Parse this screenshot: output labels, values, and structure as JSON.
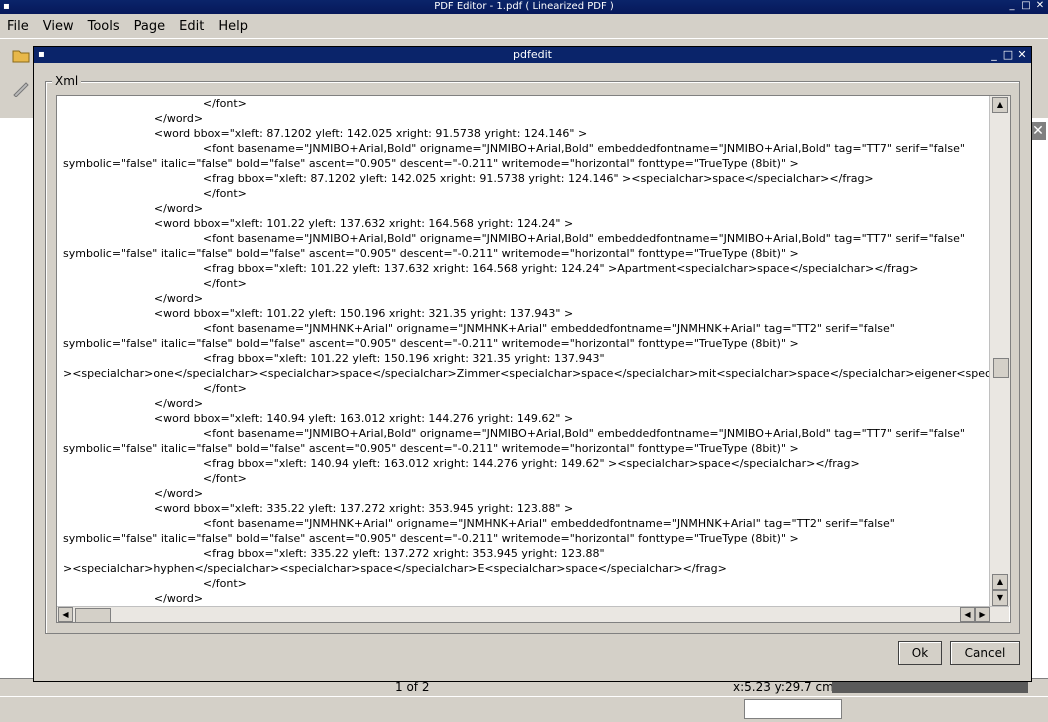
{
  "main_window": {
    "title": "PDF Editor - 1.pdf ( Linearized PDF )"
  },
  "menubar": {
    "items": [
      {
        "label": "File"
      },
      {
        "label": "View"
      },
      {
        "label": "Tools"
      },
      {
        "label": "Page"
      },
      {
        "label": "Edit"
      },
      {
        "label": "Help"
      }
    ]
  },
  "dialog": {
    "title": "pdfedit",
    "group_label": "Xml",
    "ok_label": "Ok",
    "cancel_label": "Cancel",
    "xml_lines": [
      "                                        </font>",
      "                          </word>",
      "                          <word bbox=\"xleft: 87.1202 yleft: 142.025 xright: 91.5738 yright: 124.146\" >",
      "                                        <font basename=\"JNMIBO+Arial,Bold\" origname=\"JNMIBO+Arial,Bold\" embeddedfontname=\"JNMIBO+Arial,Bold\" tag=\"TT7\" serif=\"false\"",
      "symbolic=\"false\" italic=\"false\" bold=\"false\" ascent=\"0.905\" descent=\"-0.211\" writemode=\"horizontal\" fonttype=\"TrueType (8bit)\" >",
      "                                        <frag bbox=\"xleft: 87.1202 yleft: 142.025 xright: 91.5738 yright: 124.146\" ><specialchar>space</specialchar></frag>",
      "                                        </font>",
      "                          </word>",
      "                          <word bbox=\"xleft: 101.22 yleft: 137.632 xright: 164.568 yright: 124.24\" >",
      "                                        <font basename=\"JNMIBO+Arial,Bold\" origname=\"JNMIBO+Arial,Bold\" embeddedfontname=\"JNMIBO+Arial,Bold\" tag=\"TT7\" serif=\"false\"",
      "symbolic=\"false\" italic=\"false\" bold=\"false\" ascent=\"0.905\" descent=\"-0.211\" writemode=\"horizontal\" fonttype=\"TrueType (8bit)\" >",
      "                                        <frag bbox=\"xleft: 101.22 yleft: 137.632 xright: 164.568 yright: 124.24\" >Apartment<specialchar>space</specialchar></frag>",
      "                                        </font>",
      "                          </word>",
      "                          <word bbox=\"xleft: 101.22 yleft: 150.196 xright: 321.35 yright: 137.943\" >",
      "                                        <font basename=\"JNMHNK+Arial\" origname=\"JNMHNK+Arial\" embeddedfontname=\"JNMHNK+Arial\" tag=\"TT2\" serif=\"false\"",
      "symbolic=\"false\" italic=\"false\" bold=\"false\" ascent=\"0.905\" descent=\"-0.211\" writemode=\"horizontal\" fonttype=\"TrueType (8bit)\" >",
      "                                        <frag bbox=\"xleft: 101.22 yleft: 150.196 xright: 321.35 yright: 137.943\"",
      "><specialchar>one</specialchar><specialchar>space</specialchar>Zimmer<specialchar>space</specialchar>mit<specialchar>space</specialchar>eigener<specialcha",
      "                                        </font>",
      "                          </word>",
      "                          <word bbox=\"xleft: 140.94 yleft: 163.012 xright: 144.276 yright: 149.62\" >",
      "                                        <font basename=\"JNMIBO+Arial,Bold\" origname=\"JNMIBO+Arial,Bold\" embeddedfontname=\"JNMIBO+Arial,Bold\" tag=\"TT7\" serif=\"false\"",
      "symbolic=\"false\" italic=\"false\" bold=\"false\" ascent=\"0.905\" descent=\"-0.211\" writemode=\"horizontal\" fonttype=\"TrueType (8bit)\" >",
      "                                        <frag bbox=\"xleft: 140.94 yleft: 163.012 xright: 144.276 yright: 149.62\" ><specialchar>space</specialchar></frag>",
      "                                        </font>",
      "                          </word>",
      "                          <word bbox=\"xleft: 335.22 yleft: 137.272 xright: 353.945 yright: 123.88\" >",
      "                                        <font basename=\"JNMHNK+Arial\" origname=\"JNMHNK+Arial\" embeddedfontname=\"JNMHNK+Arial\" tag=\"TT2\" serif=\"false\"",
      "symbolic=\"false\" italic=\"false\" bold=\"false\" ascent=\"0.905\" descent=\"-0.211\" writemode=\"horizontal\" fonttype=\"TrueType (8bit)\" >",
      "                                        <frag bbox=\"xleft: 335.22 yleft: 137.272 xright: 353.945 yright: 123.88\"",
      "><specialchar>hyphen</specialchar><specialchar>space</specialchar>E<specialchar>space</specialchar></frag>",
      "                                        </font>",
      "                          </word>"
    ]
  },
  "statusbar": {
    "page_indicator": "1 of 2",
    "coordinates": "x:5.23 y:29.7 cm"
  },
  "icons": {
    "folder": "folder-icon",
    "pencil": "pencil-icon",
    "close": "close-icon",
    "minimize": "minimize-icon",
    "maximize": "maximize-icon"
  },
  "colors": {
    "titlebar": "#0a246a",
    "window_bg": "#d4d0c8"
  }
}
